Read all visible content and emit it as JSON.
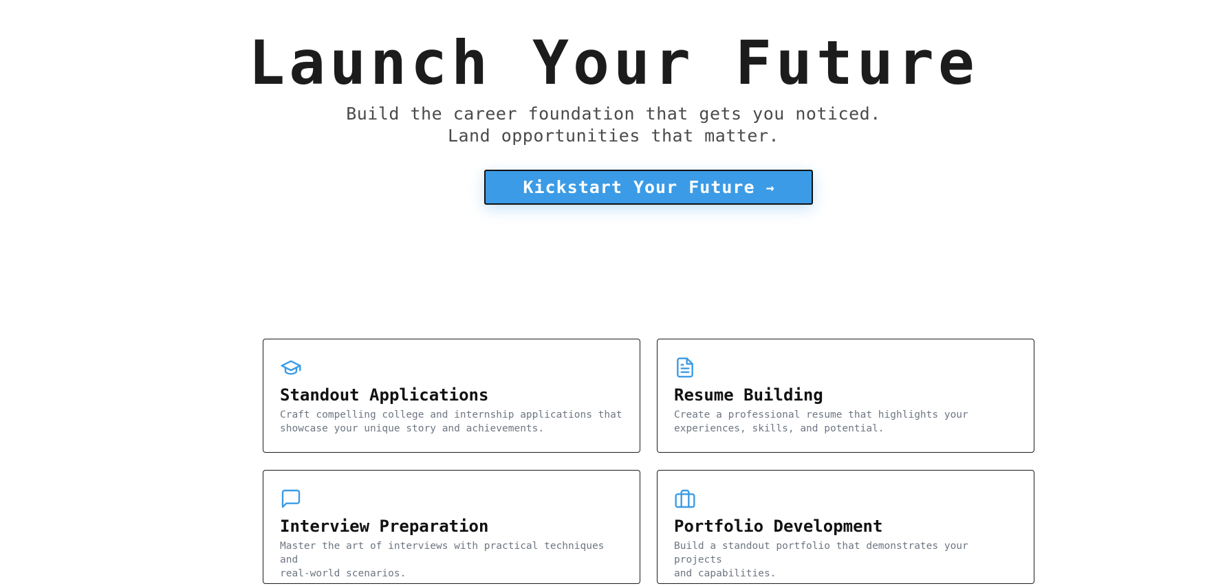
{
  "hero": {
    "title": "Launch Your Future",
    "subtitle_line1": "Build the career foundation that gets you noticed.",
    "subtitle_line2": "Land opportunities that matter.",
    "cta_label": "Kickstart Your Future",
    "cta_arrow": "→"
  },
  "colors": {
    "accent": "#3b9be6",
    "text": "#1a1a1a",
    "muted": "#6e7682"
  },
  "features": [
    {
      "icon": "graduation-cap-icon",
      "title": "Standout Applications",
      "description_line1": "Craft compelling college and internship applications that",
      "description_line2": "showcase your unique story and achievements."
    },
    {
      "icon": "document-icon",
      "title": "Resume Building",
      "description_line1": "Create a professional resume that highlights your",
      "description_line2": "experiences, skills, and potential."
    },
    {
      "icon": "chat-bubble-icon",
      "title": "Interview Preparation",
      "description_line1": "Master the art of interviews with practical techniques and",
      "description_line2": "real-world scenarios."
    },
    {
      "icon": "briefcase-icon",
      "title": "Portfolio Development",
      "description_line1": "Build a standout portfolio that demonstrates your projects",
      "description_line2": "and capabilities."
    }
  ]
}
